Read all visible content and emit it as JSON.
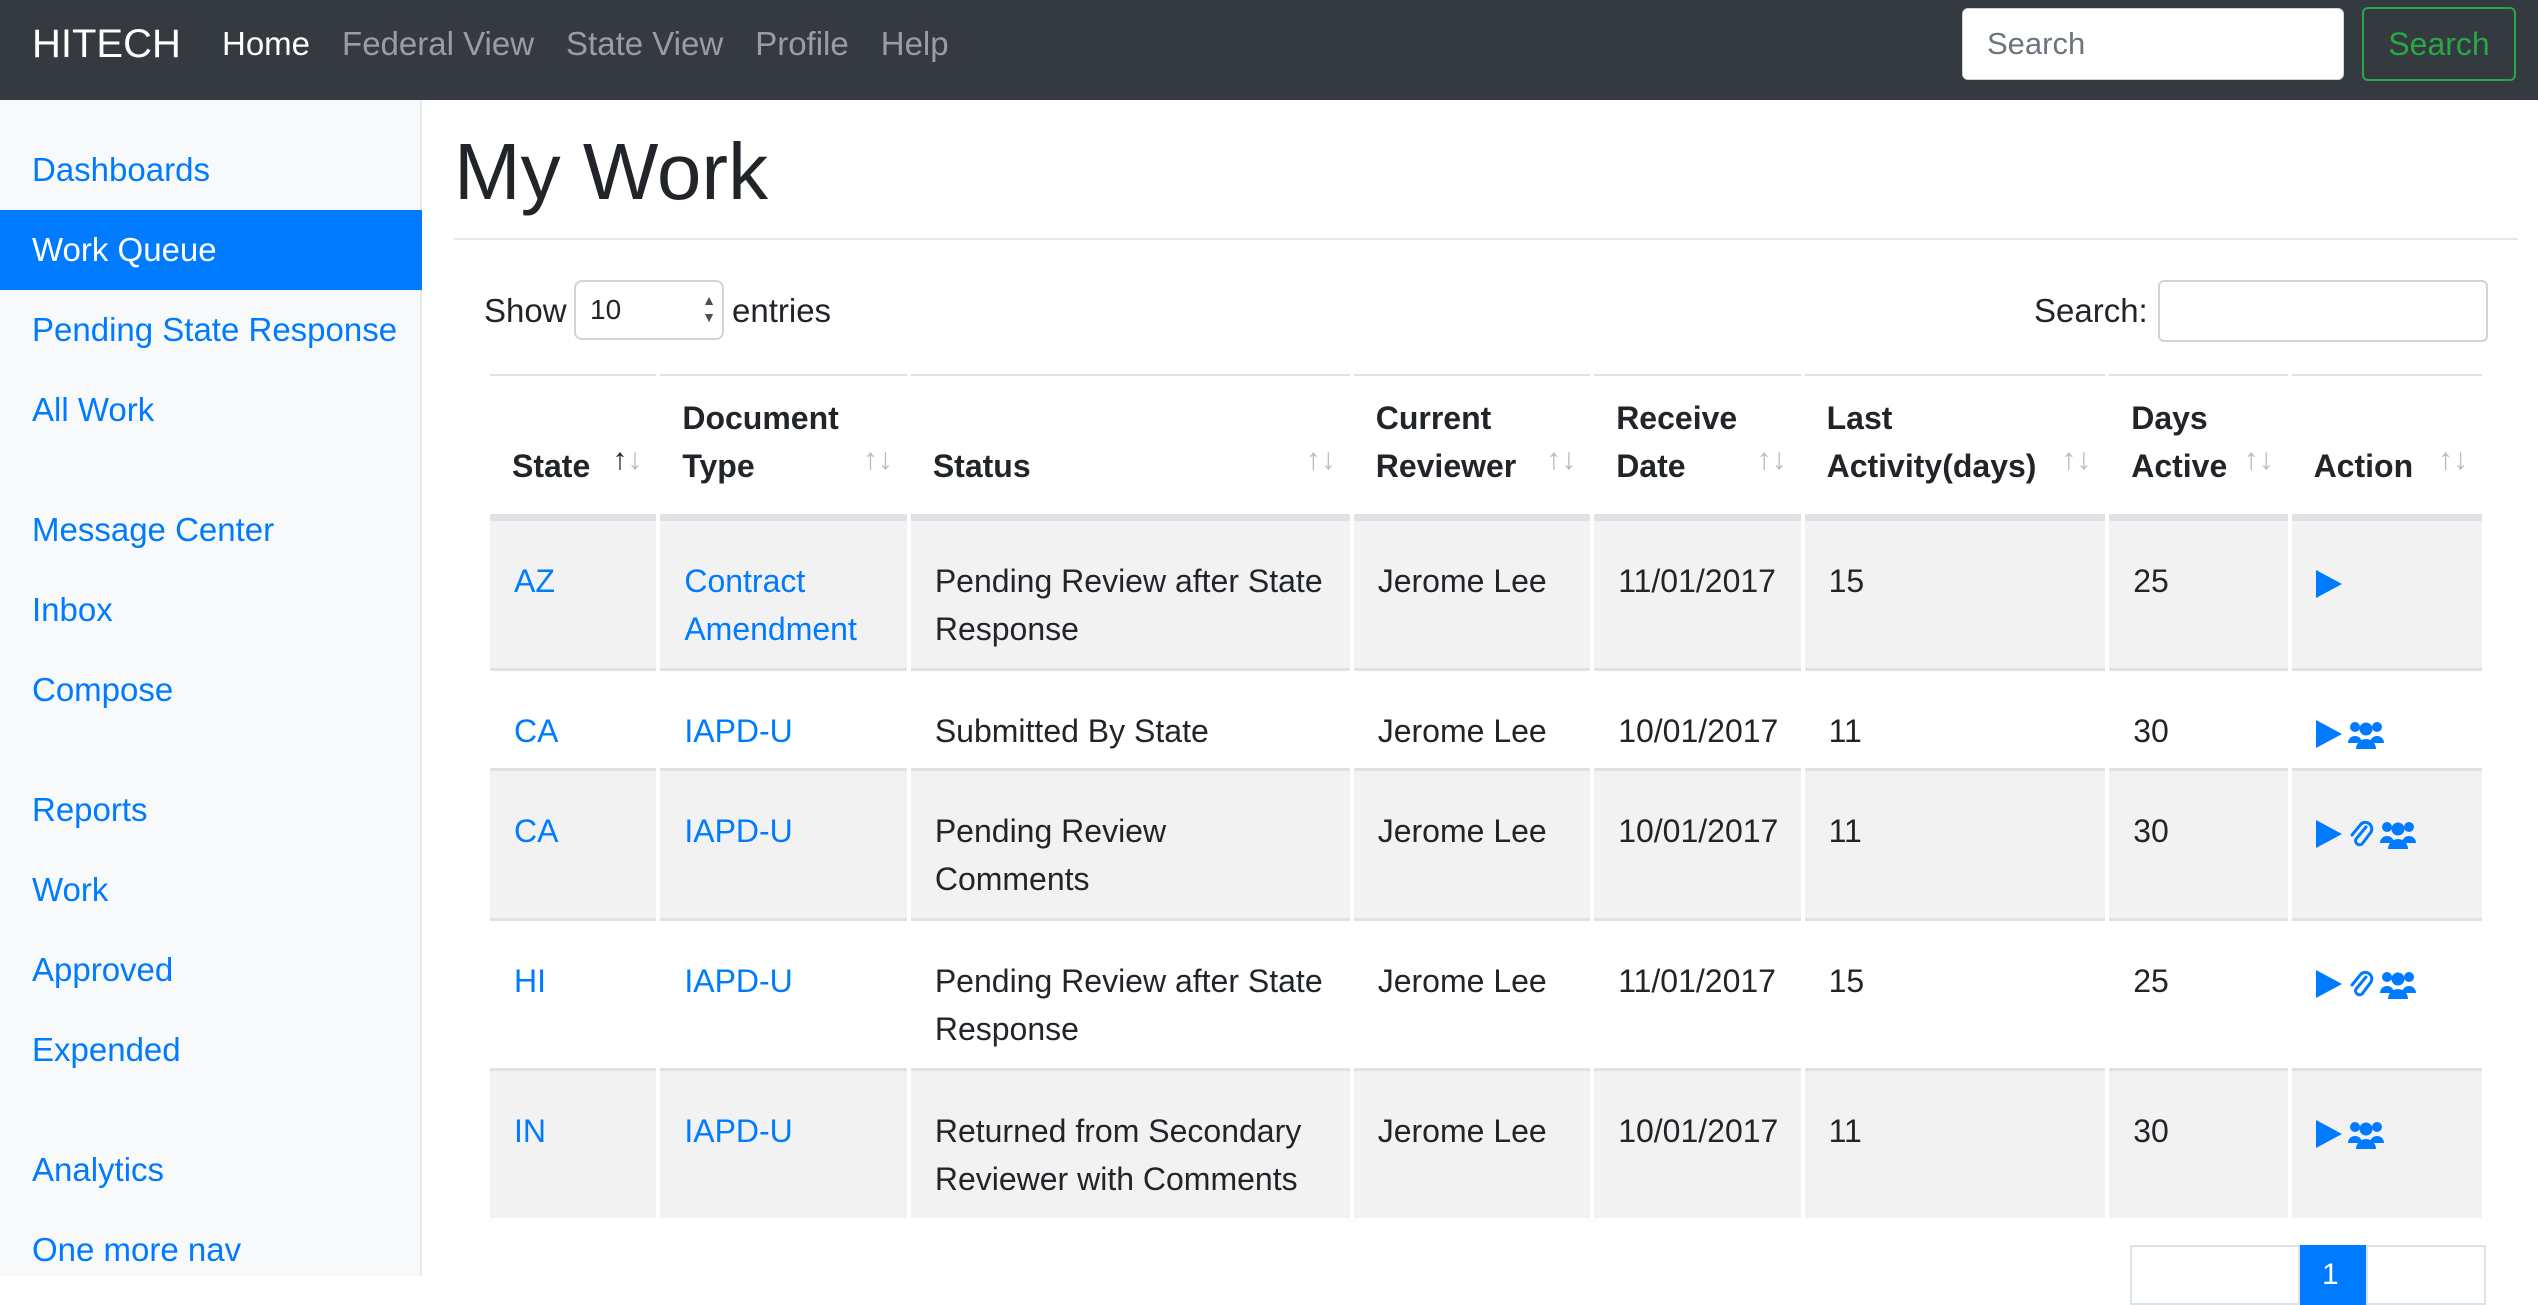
{
  "navbar": {
    "brand": "HITECH",
    "links": [
      "Home",
      "Federal View",
      "State View",
      "Profile",
      "Help"
    ],
    "search_placeholder": "Search",
    "search_button": "Search"
  },
  "sidebar": {
    "items": [
      "Dashboards",
      "Work Queue",
      "Pending State Response",
      "All Work",
      "Message Center",
      "Inbox",
      "Compose",
      "Reports",
      "Work",
      "Approved",
      "Expended",
      "Analytics",
      "One more nav"
    ],
    "active": "Work Queue"
  },
  "main": {
    "title": "My Work",
    "length": {
      "show": "Show",
      "value": "10",
      "entries": "entries"
    },
    "search_label": "Search:"
  },
  "table": {
    "headers": [
      "State",
      "Document Type",
      "Status",
      "Current Reviewer",
      "Receive Date",
      "Last Activity(days)",
      "Days Active",
      "Action"
    ],
    "rows": [
      {
        "state": "AZ",
        "doc_type": "Contract Amendment",
        "status": "Pending Review after State Response",
        "reviewer": "Jerome Lee",
        "receive_date": "11/01/2017",
        "last_activity": "15",
        "days_active": "25",
        "actions": [
          "play-icon"
        ]
      },
      {
        "state": "CA",
        "doc_type": "IAPD-U",
        "status": "Submitted By State",
        "reviewer": "Jerome Lee",
        "receive_date": "10/01/2017",
        "last_activity": "11",
        "days_active": "30",
        "actions": [
          "play-icon",
          "users-icon"
        ]
      },
      {
        "state": "CA",
        "doc_type": "IAPD-U",
        "status": "Pending Review Comments",
        "reviewer": "Jerome Lee",
        "receive_date": "10/01/2017",
        "last_activity": "11",
        "days_active": "30",
        "actions": [
          "play-icon",
          "paperclip-icon",
          "users-icon"
        ]
      },
      {
        "state": "HI",
        "doc_type": "IAPD-U",
        "status": "Pending Review after State Response",
        "reviewer": "Jerome Lee",
        "receive_date": "11/01/2017",
        "last_activity": "15",
        "days_active": "25",
        "actions": [
          "play-icon",
          "paperclip-icon",
          "users-icon"
        ]
      },
      {
        "state": "IN",
        "doc_type": "IAPD-U",
        "status": "Returned from Secondary Reviewer with Comments",
        "reviewer": "Jerome Lee",
        "receive_date": "10/01/2017",
        "last_activity": "11",
        "days_active": "30",
        "actions": [
          "play-icon",
          "users-icon"
        ]
      }
    ]
  },
  "pagination": {
    "current": "1"
  },
  "colors": {
    "navbar": "#343a40",
    "link": "#007bff",
    "success": "#28a745",
    "sidebar_bg": "#f8f9fa",
    "stripe": "#f2f2f2"
  }
}
